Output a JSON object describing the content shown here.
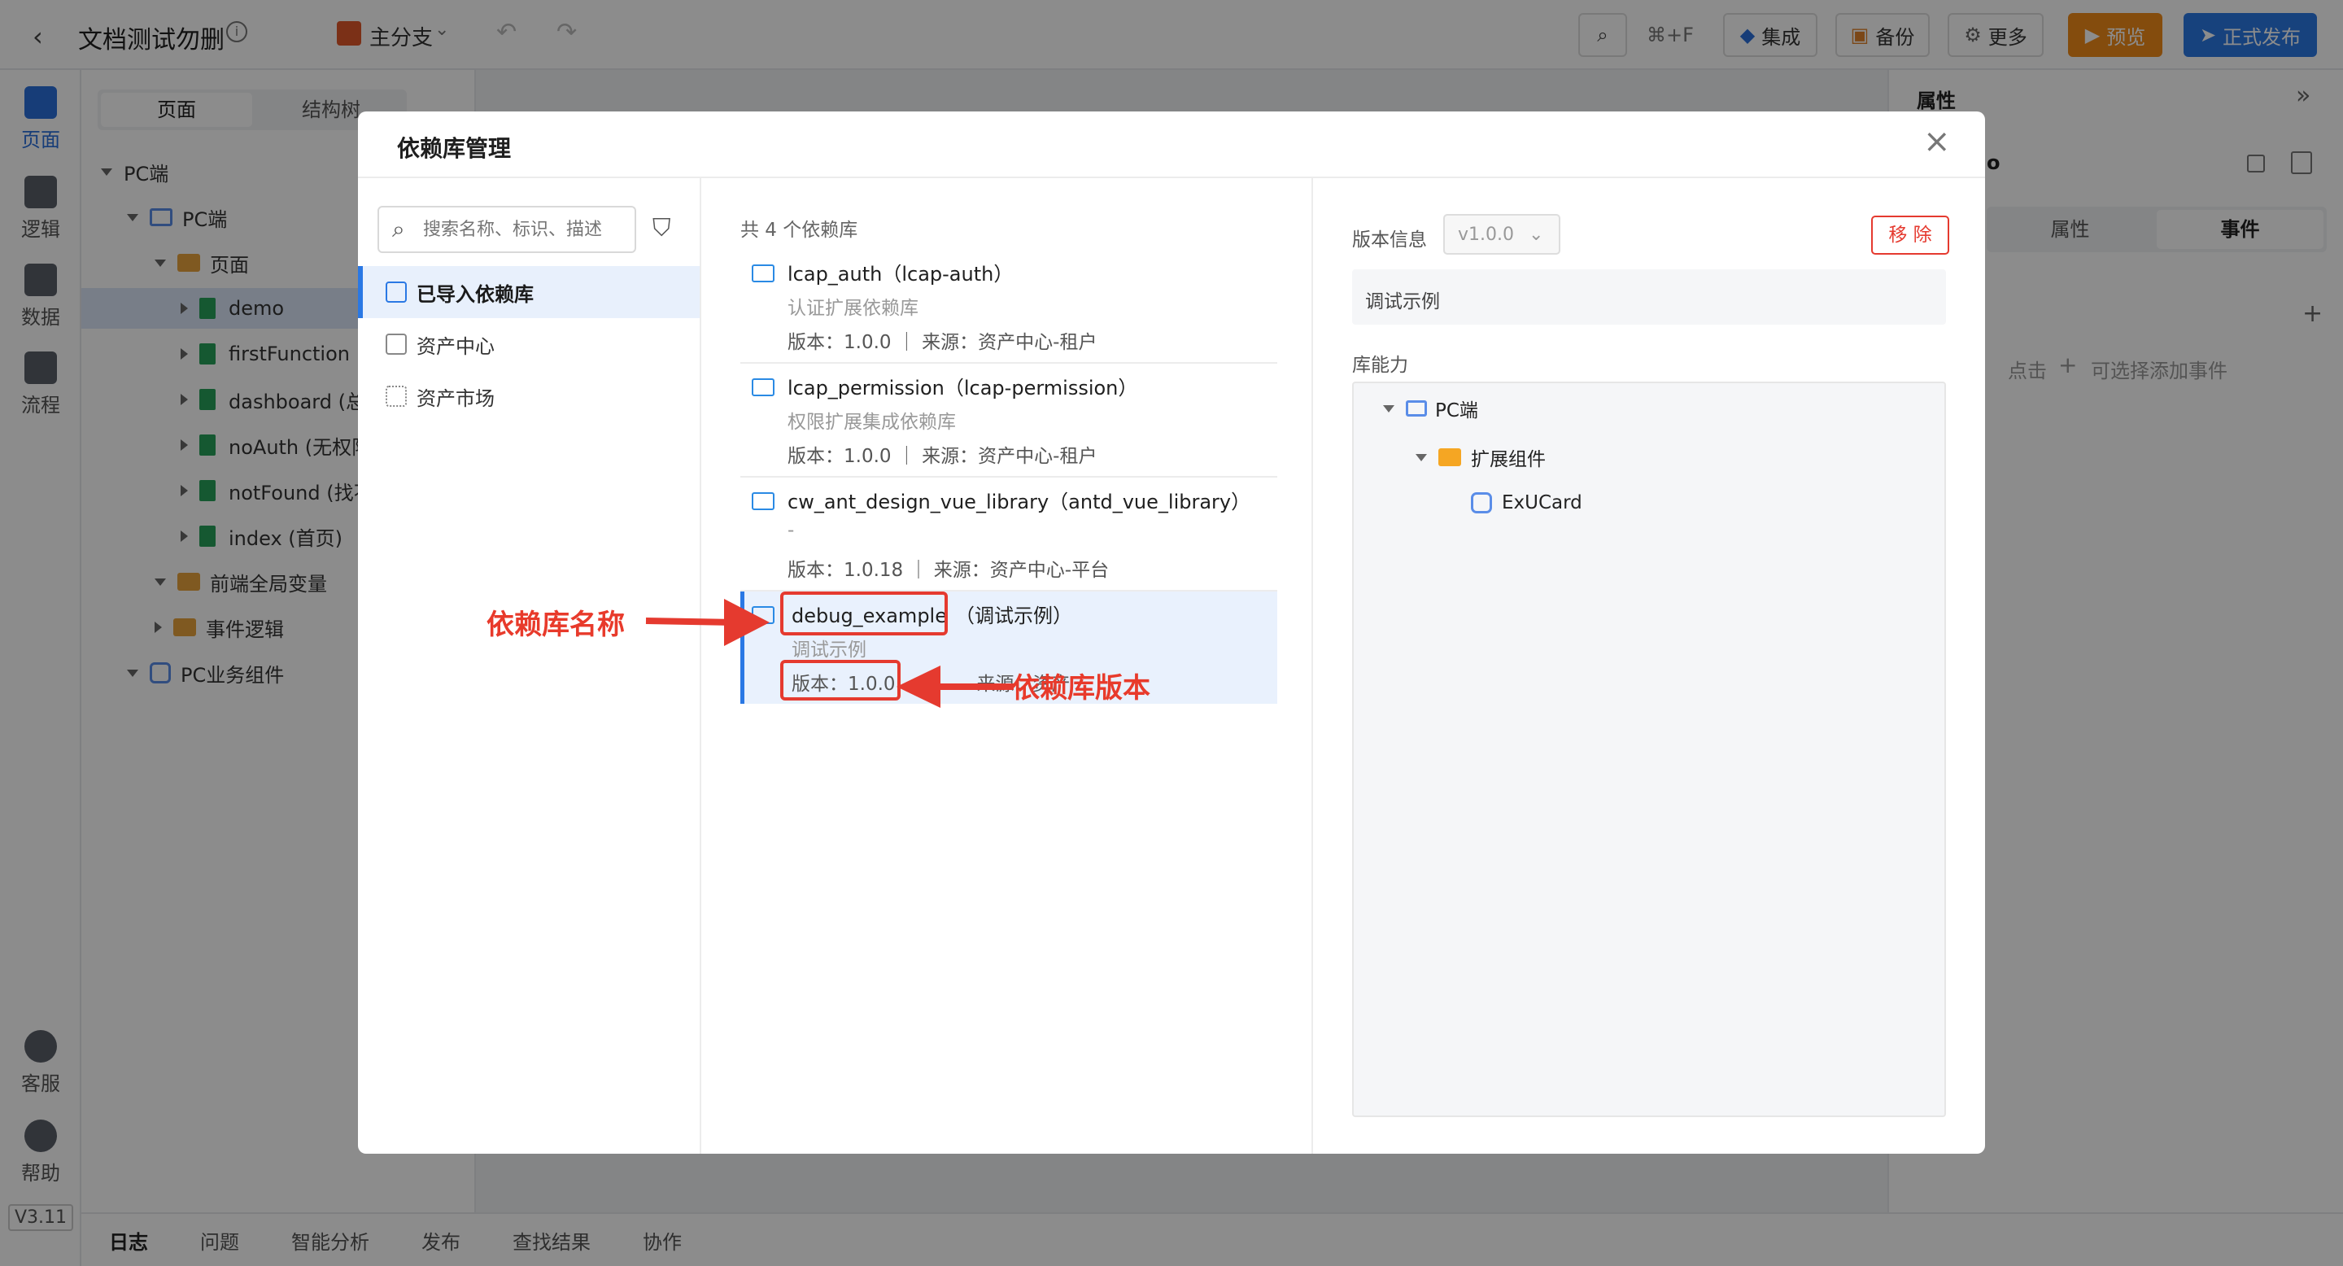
{
  "topbar": {
    "back_icon": "chevron-left-icon",
    "title": "文档测试勿删",
    "branch": "主分支",
    "shortcut": "⌘+F",
    "integrate": "集成",
    "backup": "备份",
    "more": "更多",
    "preview": "预览",
    "publish": "正式发布"
  },
  "leftbar": {
    "items": [
      {
        "label": "页面",
        "icon": "page-icon"
      },
      {
        "label": "逻辑",
        "icon": "logic-icon"
      },
      {
        "label": "数据",
        "icon": "database-icon"
      },
      {
        "label": "流程",
        "icon": "flow-icon"
      }
    ],
    "service": "客服",
    "help": "帮助",
    "version": "V3.11"
  },
  "tree": {
    "tabs": [
      "页面",
      "结构树"
    ],
    "rows": [
      {
        "label": "PC端"
      },
      {
        "label": "PC端"
      },
      {
        "label": "页面"
      },
      {
        "label": "demo"
      },
      {
        "label": "firstFunction"
      },
      {
        "label": "dashboard (总"
      },
      {
        "label": "noAuth (无权限"
      },
      {
        "label": "notFound (找不"
      },
      {
        "label": "index (首页)"
      },
      {
        "label": "前端全局变量"
      },
      {
        "label": "事件逻辑"
      },
      {
        "label": "PC业务组件"
      }
    ]
  },
  "right_panel": {
    "title": "属性",
    "tab_props": "属性",
    "tab_events": "事件",
    "partial": "o",
    "hint_click": "点击",
    "hint_add": "可选择添加事件"
  },
  "bottombar": {
    "tabs": [
      "日志",
      "问题",
      "智能分析",
      "发布",
      "查找结果",
      "协作"
    ]
  },
  "modal": {
    "title": "依赖库管理",
    "search_placeholder": "搜索名称、标识、描述",
    "nav": [
      {
        "label": "已导入依赖库"
      },
      {
        "label": "资产中心"
      },
      {
        "label": "资产市场"
      }
    ],
    "count_text": "共 4 个依赖库",
    "libraries": [
      {
        "name": "lcap_auth（lcap-auth）",
        "desc": "认证扩展依赖库",
        "meta": "版本：1.0.0 ｜ 来源：资产中心-租户"
      },
      {
        "name": "lcap_permission（lcap-permission）",
        "desc": "权限扩展集成依赖库",
        "meta": "版本：1.0.0 ｜ 来源：资产中心-租户"
      },
      {
        "name": "cw_ant_design_vue_library（antd_vue_library）",
        "desc": "-",
        "meta": "版本：1.0.18 ｜ 来源：资产中心-平台"
      },
      {
        "name": "debug_example",
        "name_suffix": "（调试示例）",
        "desc": "调试示例",
        "meta": "版本：1.0.0",
        "meta_tail": "来源：资产"
      }
    ],
    "detail": {
      "version_label": "版本信息",
      "version_value": "v1.0.0",
      "remove": "移 除",
      "description": "调试示例",
      "capability_label": "库能力",
      "tree": [
        {
          "label": "PC端"
        },
        {
          "label": "扩展组件"
        },
        {
          "label": "ExUCard"
        }
      ]
    }
  },
  "annotations": {
    "name_label": "依赖库名称",
    "version_label": "依赖库版本"
  }
}
